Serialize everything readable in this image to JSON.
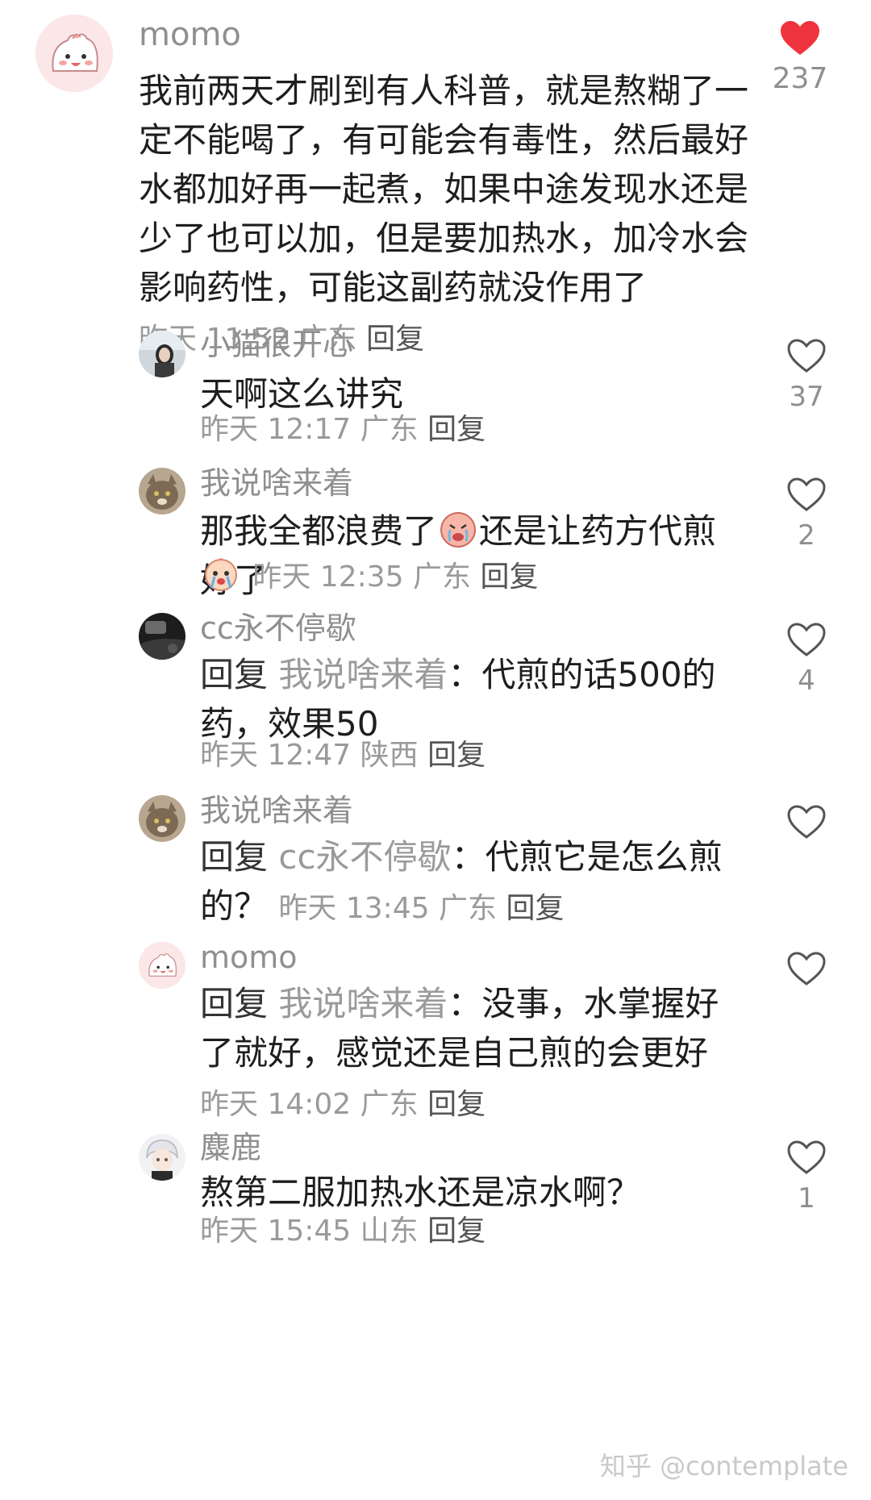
{
  "main_comment": {
    "author": "momo",
    "text": "我前两天才刷到有人科普，就是熬糊了一定不能喝了，有可能会有毒性，然后最好水都加好再一起煮，如果中途发现水还是少了也可以加，但是要加热水，加冷水会影响药性，可能这副药就没作用了",
    "time": "昨天 11:52",
    "location": "广东",
    "reply_label": "回复",
    "likes": "237",
    "liked": true,
    "avatar_icon": "cute-pink-blob-avatar"
  },
  "replies": [
    {
      "author": "小猫很开心",
      "text": "天啊这么讲究",
      "time": "昨天 12:17",
      "location": "广东",
      "reply_label": "回复",
      "likes": "37",
      "avatar_icon": "girl-photo-avatar"
    },
    {
      "author": "我说啥来着",
      "text_a": "那我全都浪费了",
      "text_b": "还是让药方代煎好了",
      "emoji_1": "sad-crying-face-emoji",
      "emoji_2": "tearful-face-emoji",
      "time": "昨天 12:35",
      "location": "广东",
      "reply_label": "回复",
      "likes": "2",
      "avatar_icon": "cat-photo-avatar"
    },
    {
      "author": "cc永不停歇",
      "reply_prefix": "回复",
      "reply_to": "我说啥来着",
      "text": "：代煎的话500的药，效果50",
      "time": "昨天 12:47",
      "location": "陕西",
      "reply_label": "回复",
      "likes": "4",
      "avatar_icon": "car-interior-avatar"
    },
    {
      "author": "我说啥来着",
      "reply_prefix": "回复",
      "reply_to": "cc永不停歇",
      "text": "：代煎它是怎么煎的？",
      "time": "昨天 13:45",
      "location": "广东",
      "reply_label": "回复",
      "likes": "",
      "avatar_icon": "cat-photo-avatar"
    },
    {
      "author": "momo",
      "reply_prefix": "回复",
      "reply_to": "我说啥来着",
      "text": "：没事，水掌握好了就好，感觉还是自己煎的会更好",
      "time": "昨天 14:02",
      "location": "广东",
      "reply_label": "回复",
      "likes": "",
      "avatar_icon": "cute-pink-blob-avatar"
    },
    {
      "author": "麋鹿",
      "text": "熬第二服加热水还是凉水啊？",
      "time": "昨天 15:45",
      "location": "山东",
      "reply_label": "回复",
      "likes": "1",
      "avatar_icon": "white-hair-boy-avatar"
    }
  ],
  "watermark": "知乎 @contemplate",
  "colors": {
    "liked_heart": "#f0343f",
    "meta_gray": "#9a9a9a",
    "text": "#1e1e1e"
  }
}
